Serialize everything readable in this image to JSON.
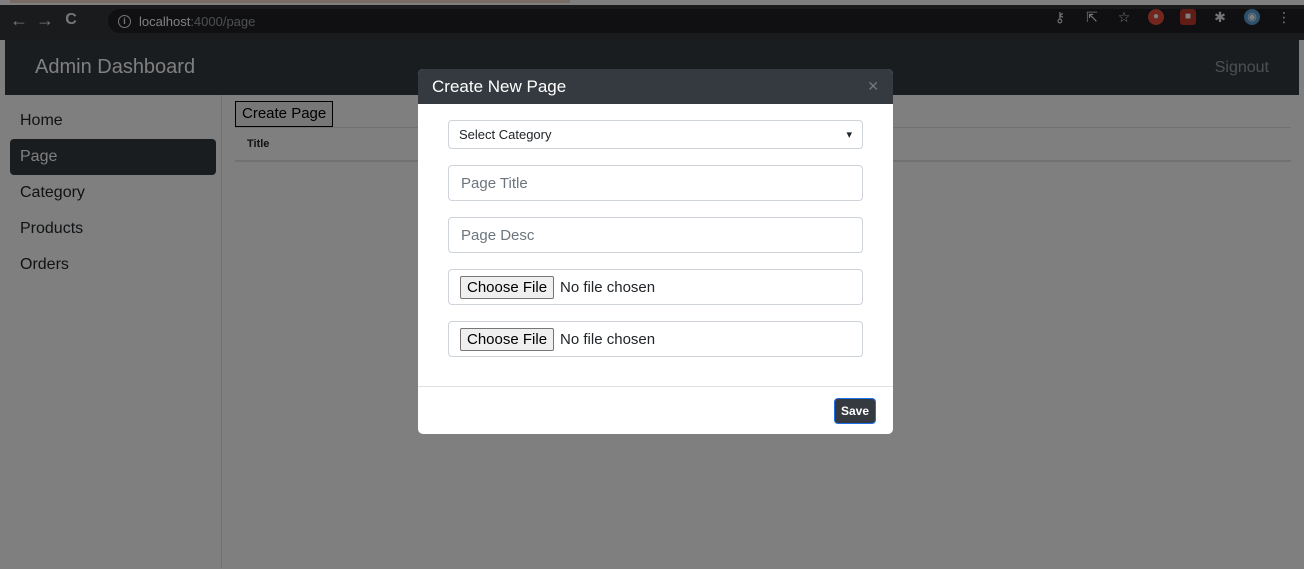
{
  "browser": {
    "url_host": "localhost",
    "url_path": ":4000/page",
    "back_glyph": "←",
    "forward_glyph": "→",
    "reload_glyph": "C",
    "info_glyph": "i"
  },
  "header": {
    "brand": "Admin Dashboard",
    "signout": "Signout"
  },
  "sidebar": {
    "items": [
      {
        "label": "Home"
      },
      {
        "label": "Page",
        "active": true
      },
      {
        "label": "Category"
      },
      {
        "label": "Products"
      },
      {
        "label": "Orders"
      }
    ]
  },
  "main": {
    "create_button": "Create Page",
    "table_header": "Title"
  },
  "modal": {
    "title": "Create New Page",
    "close_glyph": "✕",
    "select_value": "Select Category",
    "title_placeholder": "Page Title",
    "desc_placeholder": "Page Desc",
    "file_button": "Choose File",
    "file_status": "No file chosen",
    "save": "Save"
  },
  "colors": {
    "header_bg": "#343a40",
    "browser_bg": "#35363a"
  }
}
